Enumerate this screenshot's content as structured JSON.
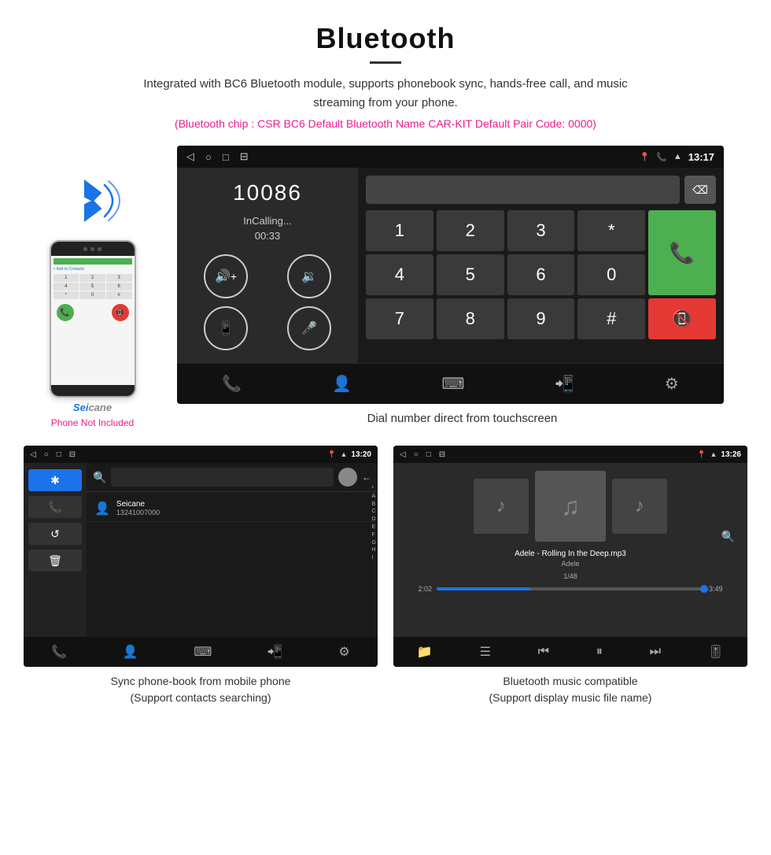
{
  "header": {
    "title": "Bluetooth",
    "description": "Integrated with BC6 Bluetooth module, supports phonebook sync, hands-free call, and music streaming from your phone.",
    "specs": "(Bluetooth chip : CSR BC6    Default Bluetooth Name CAR-KIT    Default Pair Code: 0000)"
  },
  "dial_screen": {
    "status_bar": {
      "time": "13:17"
    },
    "number": "10086",
    "call_status": "InCalling...",
    "call_timer": "00:33",
    "numpad": [
      "1",
      "2",
      "3",
      "*",
      "4",
      "5",
      "6",
      "0",
      "7",
      "8",
      "9",
      "#"
    ]
  },
  "dial_caption": "Dial number direct from touchscreen",
  "phone_not_included": "Phone Not Included",
  "phonebook_screen": {
    "status_bar": {
      "time": "13:20"
    },
    "contact_name": "Seicane",
    "contact_number": "13241007000",
    "alpha_list": [
      "*",
      "A",
      "B",
      "C",
      "D",
      "E",
      "F",
      "G",
      "H",
      "I"
    ]
  },
  "phonebook_caption_line1": "Sync phone-book from mobile phone",
  "phonebook_caption_line2": "(Support contacts searching)",
  "music_screen": {
    "status_bar": {
      "time": "13:26"
    },
    "song_title": "Adele - Rolling In the Deep.mp3",
    "artist": "Adele",
    "track_info": "1/48",
    "time_current": "2:02",
    "time_total": "3:49"
  },
  "music_caption_line1": "Bluetooth music compatible",
  "music_caption_line2": "(Support display music file name)"
}
